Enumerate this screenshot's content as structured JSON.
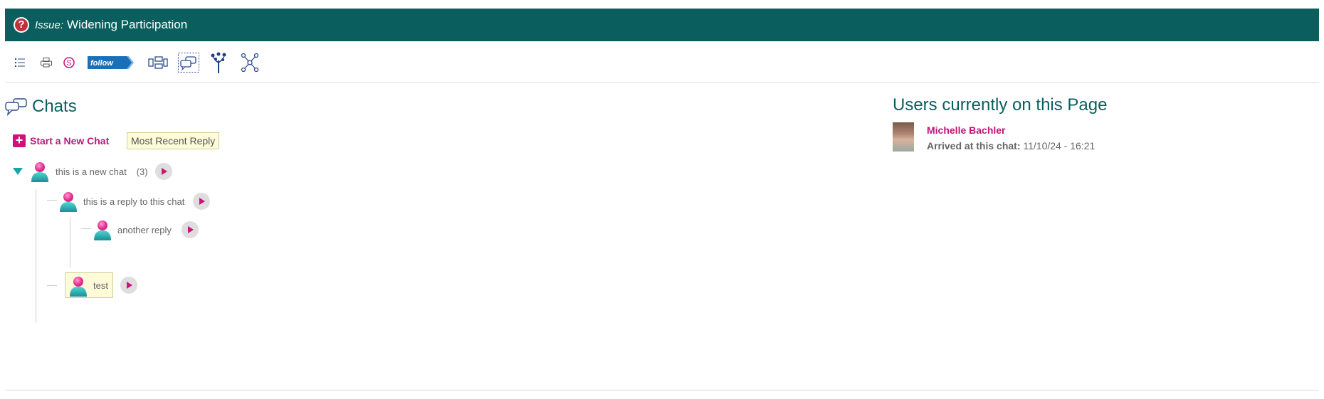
{
  "header": {
    "prefix": "Issue:",
    "title": "Widening Participation"
  },
  "toolbar": {
    "items": [
      {
        "icon": "list-icon"
      },
      {
        "icon": "print-icon"
      },
      {
        "icon": "skype-icon"
      },
      {
        "icon": "follow-badge-icon",
        "label": "follow"
      },
      {
        "icon": "layout-view-icon"
      },
      {
        "icon": "chat-view-icon"
      },
      {
        "icon": "tree-icon"
      },
      {
        "icon": "network-icon"
      }
    ]
  },
  "chats": {
    "heading": "Chats",
    "new_chat_label": "Start a New Chat",
    "most_recent_reply_label": "Most Recent Reply",
    "threads": [
      {
        "text": "this is a new chat",
        "count": "(3)"
      },
      {
        "text": "this is a reply to this chat"
      },
      {
        "text": "another reply"
      },
      {
        "text": "test"
      }
    ]
  },
  "users": {
    "heading": "Users currently on this Page",
    "list": [
      {
        "name": "Michelle Bachler",
        "arrived_label": "Arrived at this chat:",
        "arrived_value": "11/10/24 - 16:21"
      }
    ]
  },
  "colors": {
    "header_bg": "#0a5f5e",
    "accent": "#c0157a",
    "heading": "#0a5f5e"
  }
}
